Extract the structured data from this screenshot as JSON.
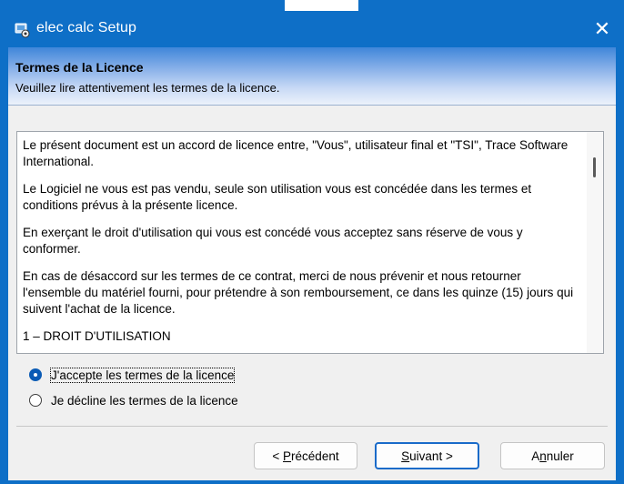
{
  "window": {
    "title": "elec calc Setup",
    "close_glyph": "✕",
    "accent_color": "#0e6fc7",
    "icon": "setup-app-icon"
  },
  "header": {
    "title": "Termes de la Licence",
    "subtitle": "Veuillez lire attentivement les termes de la licence."
  },
  "license": {
    "paragraphs": [
      "Le présent document est un accord de licence entre, \"Vous\", utilisateur final et \"TSI\", Trace Software International.",
      "Le Logiciel ne vous est pas vendu, seule son utilisation vous est concédée dans les termes et conditions prévus à la présente licence.",
      "En exerçant le droit d'utilisation qui vous est concédé vous acceptez sans réserve de vous y conformer.",
      "En cas de désaccord sur les termes de ce contrat, merci de nous prévenir et nous retourner l'ensemble du matériel fourni, pour prétendre à son remboursement, ce dans les quinze (15) jours qui suivent l'achat de la licence.",
      "1 – DROIT D'UTILISATION"
    ]
  },
  "options": {
    "accept": {
      "label": "J'accepte les termes de la licence",
      "selected": true
    },
    "decline": {
      "label": "Je décline les termes de la licence",
      "selected": false
    }
  },
  "buttons": {
    "back": {
      "pre": "< ",
      "mnemonic": "P",
      "rest": "récédent"
    },
    "next": {
      "mnemonic": "S",
      "rest": "uivant >"
    },
    "cancel": {
      "pre": "A",
      "mnemonic": "n",
      "rest": "nuler"
    }
  }
}
